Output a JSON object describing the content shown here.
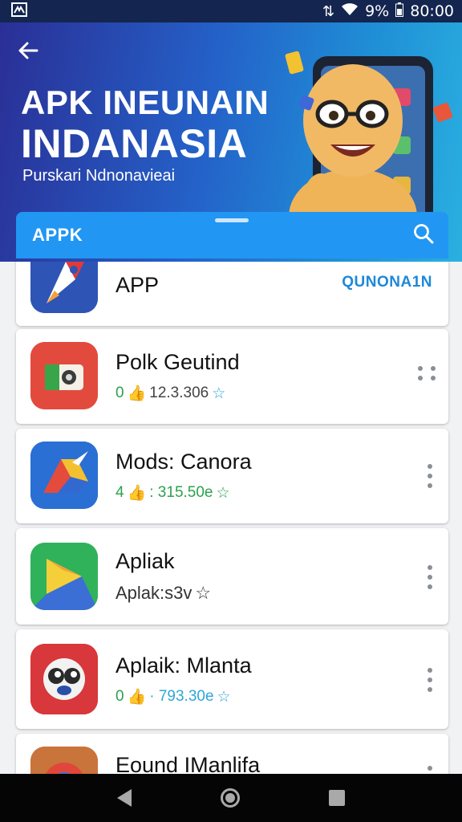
{
  "status_bar": {
    "battery": "9%",
    "time": "80:00"
  },
  "hero": {
    "title_line1": "APK INEUNAIN",
    "title_line2": "INDANASIA",
    "subtitle": "Purskari Ndnonavieai"
  },
  "search_bar": {
    "label": "APPK"
  },
  "apps": [
    {
      "name": "APP",
      "action": "QUNONA1N"
    },
    {
      "name": "Polk Geutind",
      "meta_prefix": "0",
      "meta_value": "12.3.306"
    },
    {
      "name": "Mods: Canora",
      "meta_prefix": "4",
      "meta_value": ": 315.50e"
    },
    {
      "name": "Apliak",
      "meta_text": "Aplak:s3v"
    },
    {
      "name": "Aplaik: Mlanta",
      "meta_prefix": "0",
      "meta_value": "· 793.30e"
    },
    {
      "name": "Eound IManlifa"
    }
  ],
  "colors": {
    "status_bar": "#14264f",
    "accent_blue": "#2196f3",
    "green": "#2ba24c",
    "nav_bar": "#050505"
  }
}
